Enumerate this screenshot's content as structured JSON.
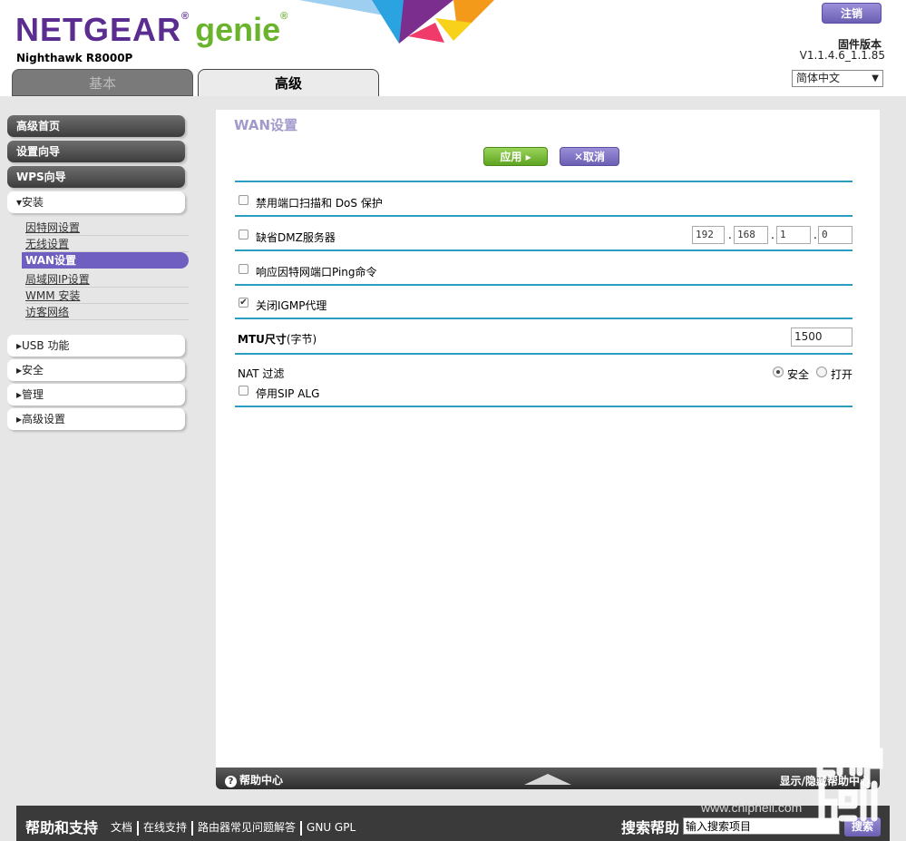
{
  "header": {
    "logo_netgear": "NETGEAR",
    "logo_reg": "®",
    "logo_genie": "genie",
    "logo_reg2": "®",
    "model": "Nighthawk R8000P",
    "logout_label": "注销",
    "firmware_label": "固件版本",
    "firmware_version": "V1.1.4.6_1.1.85",
    "language": "简体中文",
    "tabs": [
      {
        "label": "基本"
      },
      {
        "label": "高级"
      }
    ]
  },
  "sidebar": {
    "top_items": [
      {
        "label": "高级首页"
      },
      {
        "label": "设置向导"
      },
      {
        "label": "WPS向导"
      }
    ],
    "setup_label": "▾安装",
    "setup_items": [
      {
        "label": "因特网设置"
      },
      {
        "label": "无线设置"
      },
      {
        "label": "WAN设置"
      },
      {
        "label": "局域网IP设置"
      },
      {
        "label": "WMM 安装"
      },
      {
        "label": "访客网络"
      }
    ],
    "collapsed_items": [
      {
        "label": "▸USB 功能"
      },
      {
        "label": "▸安全"
      },
      {
        "label": "▸管理"
      },
      {
        "label": "▸高级设置"
      }
    ]
  },
  "main": {
    "title": "WAN设置",
    "apply_label": "应用 ▸",
    "cancel_label": "✕取消",
    "options": {
      "disable_portscan": {
        "label": "禁用端口扫描和 DoS 保护",
        "checked": false
      },
      "default_dmz": {
        "label": "缺省DMZ服务器",
        "checked": false
      },
      "ping": {
        "label": "响应因特网端口Ping命令",
        "checked": false
      },
      "igmp": {
        "label": "关闭IGMP代理",
        "checked": true
      },
      "sip_alg": {
        "label": "停用SIP ALG",
        "checked": false
      }
    },
    "dmz_ip": [
      "192",
      "168",
      "1",
      "0"
    ],
    "mtu_label_bold": "MTU尺寸",
    "mtu_label_unit": "(字节)",
    "mtu_value": "1500",
    "nat_label": "NAT 过滤",
    "nat_secure": "安全",
    "nat_open": "打开",
    "nat_selected": "安全"
  },
  "panel_footer": {
    "help_center": "帮助中心",
    "toggle_help": "显示/隐藏帮助中心"
  },
  "bottom_bar": {
    "title": "帮助和支持",
    "links": [
      "文档",
      "在线支持",
      "路由器常见问题解答",
      "GNU GPL"
    ],
    "search_label": "搜索帮助",
    "search_value": "输入搜索项目",
    "search_button": "搜索"
  },
  "watermark": {
    "url": "www.chiphell.com"
  }
}
